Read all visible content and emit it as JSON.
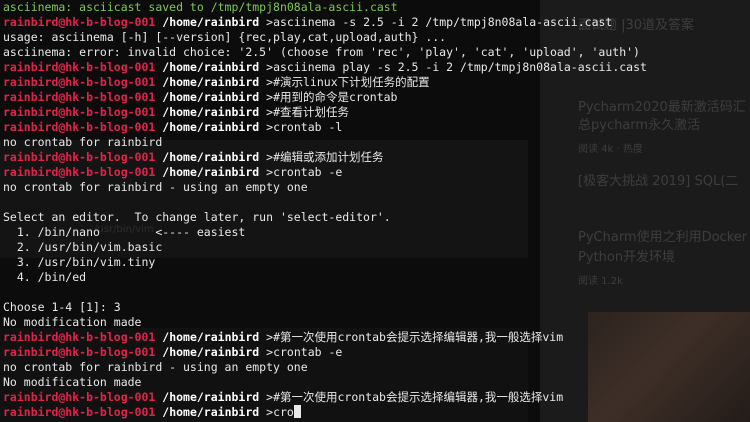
{
  "terminal": {
    "prompt": {
      "user_host": "rainbird@hk-b-blog-001",
      "path": "/home/rainbird",
      "symbol": ">"
    },
    "lines": [
      {
        "kind": "notice",
        "text": "asciinema: asciicast saved to /tmp/tmpj8n08ala-ascii.cast"
      },
      {
        "kind": "prompt",
        "cmd": "asciinema -s 2.5 -i 2 /tmp/tmpj8n08ala-ascii.cast"
      },
      {
        "kind": "output",
        "text": "usage: asciinema [-h] [--version] {rec,play,cat,upload,auth} ..."
      },
      {
        "kind": "output",
        "text": "asciinema: error: invalid choice: '2.5' (choose from 'rec', 'play', 'cat', 'upload', 'auth')"
      },
      {
        "kind": "prompt",
        "cmd": "asciinema play -s 2.5 -i 2 /tmp/tmpj8n08ala-ascii.cast"
      },
      {
        "kind": "prompt",
        "cmd": "#演示linux下计划任务的配置"
      },
      {
        "kind": "prompt",
        "cmd": "#用到的命令是crontab"
      },
      {
        "kind": "prompt",
        "cmd": "#查看计划任务"
      },
      {
        "kind": "prompt",
        "cmd": "crontab -l"
      },
      {
        "kind": "output",
        "text": "no crontab for rainbird"
      },
      {
        "kind": "prompt",
        "cmd": "#编辑或添加计划任务"
      },
      {
        "kind": "prompt",
        "cmd": "crontab -e"
      },
      {
        "kind": "output",
        "text": "no crontab for rainbird - using an empty one"
      },
      {
        "kind": "output",
        "text": ""
      },
      {
        "kind": "output",
        "text": "Select an editor.  To change later, run 'select-editor'."
      },
      {
        "kind": "output",
        "text": "  1. /bin/nano        <---- easiest"
      },
      {
        "kind": "output",
        "text": "  2. /usr/bin/vim.basic"
      },
      {
        "kind": "output",
        "text": "  3. /usr/bin/vim.tiny"
      },
      {
        "kind": "output",
        "text": "  4. /bin/ed"
      },
      {
        "kind": "output",
        "text": ""
      },
      {
        "kind": "output",
        "text": "Choose 1-4 [1]: 3"
      },
      {
        "kind": "output",
        "text": "No modification made"
      },
      {
        "kind": "prompt",
        "cmd": "#第一次使用crontab会提示选择编辑器,我一般选择vim"
      },
      {
        "kind": "prompt",
        "cmd": "crontab -e"
      },
      {
        "kind": "output",
        "text": "no crontab for rainbird - using an empty one"
      },
      {
        "kind": "output",
        "text": "No modification made"
      },
      {
        "kind": "prompt",
        "cmd": "#第一次使用crontab会提示选择编辑器,我一般选择vim"
      },
      {
        "kind": "prompt",
        "cmd": "cro",
        "cursor": true
      }
    ]
  },
  "background_page": {
    "links": [
      {
        "text": "面试题 |30道及答案"
      },
      {
        "text": "Pycharm2020最新激活码汇"
      },
      {
        "text": "总pycharm永久激活"
      },
      {
        "text": "[极客大挑战 2019] SQL(二"
      },
      {
        "text": "PyCharm使用之利用Docker"
      },
      {
        "text": "Python开发环境"
      }
    ],
    "meta": [
      {
        "text": "阅读 4k · 热度"
      },
      {
        "text": "阅读 1.2k"
      }
    ],
    "fragment": "/usr/bin/vim"
  },
  "colors": {
    "notice": "#7ec75a",
    "prompt_user_host": "#e0234a",
    "prompt_path": "#ffffff",
    "text": "#e8e8e8",
    "background": "#0c0c0c"
  }
}
